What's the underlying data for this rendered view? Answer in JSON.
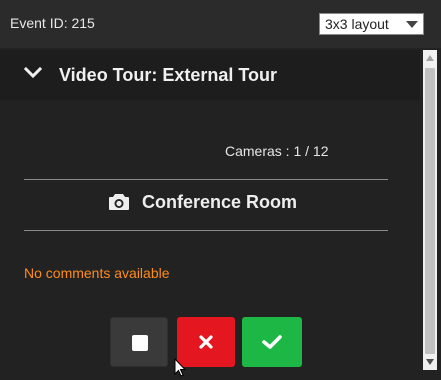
{
  "header": {
    "event_id_label": "Event ID: 215",
    "layout_select": {
      "selected": "3x3 layout"
    }
  },
  "panel": {
    "title": "Video Tour: External Tour",
    "cameras_label": "Cameras : 1 / 12",
    "camera_name": "Conference Room",
    "comments": "No comments available"
  },
  "colors": {
    "comment_text": "#ff8c1a",
    "cancel_button": "#e4161f",
    "confirm_button": "#1db745",
    "stop_button": "#3a3a3a"
  },
  "icons": {
    "collapse": "chevron-down-icon",
    "camera": "camera-icon",
    "stop": "stop-icon",
    "cancel": "close-icon",
    "confirm": "check-icon"
  }
}
